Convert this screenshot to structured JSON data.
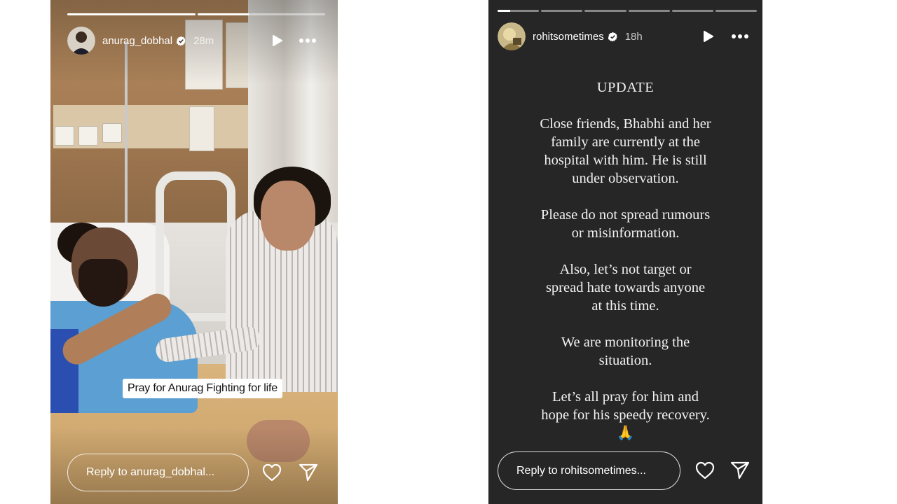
{
  "left_story": {
    "progress": [
      1.0,
      0.4
    ],
    "username": "anurag_dobhal",
    "time": "28m",
    "sticker_text": "Pray for Anurag Fighting for life",
    "reply_placeholder": "Reply to anurag_dobhal..."
  },
  "right_story": {
    "progress": [
      0.3,
      0,
      0,
      0,
      0,
      0
    ],
    "username": "rohitsometimes",
    "time": "18h",
    "title": "UPDATE",
    "paragraphs": [
      [
        "Close friends, Bhabhi and her",
        "family are currently at the",
        "hospital with him. He is still",
        "under observation."
      ],
      [
        "Please do not spread rumours",
        "or misinformation."
      ],
      [
        "Also, let’s not target or",
        "spread hate towards anyone",
        "at this time."
      ],
      [
        "We are monitoring the",
        "situation."
      ],
      [
        "Let’s all pray for him and",
        "hope for his speedy recovery.",
        "🙏"
      ]
    ],
    "reply_placeholder": "Reply to rohitsometimes..."
  },
  "colors": {
    "verified": "#3897f0",
    "right_background": "#262626"
  },
  "icons": [
    "verified-badge-icon",
    "play-icon",
    "more-options-icon",
    "like-heart-icon",
    "send-direct-icon"
  ]
}
